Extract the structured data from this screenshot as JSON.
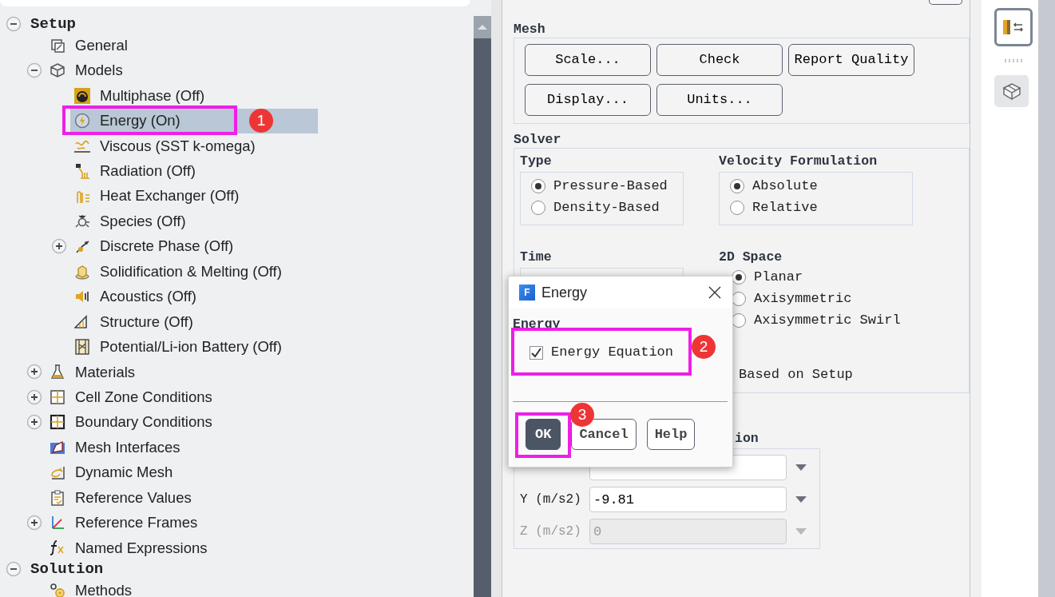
{
  "tree": [
    {
      "label": "Setup",
      "kind": "section",
      "expanded": true,
      "selected": false,
      "children": [
        {
          "label": "General",
          "kind": "general",
          "selected": false
        },
        {
          "label": "Models",
          "kind": "models",
          "expanded": true,
          "selected": false,
          "children": [
            {
              "label": "Multiphase (Off)",
              "kind": "multiphase",
              "selected": false
            },
            {
              "label": "Energy (On)",
              "kind": "energy",
              "selected": true
            },
            {
              "label": "Viscous (SST k-omega)",
              "kind": "viscous",
              "selected": false
            },
            {
              "label": "Radiation (Off)",
              "kind": "radiation",
              "selected": false
            },
            {
              "label": "Heat Exchanger (Off)",
              "kind": "exchanger",
              "selected": false
            },
            {
              "label": "Species (Off)",
              "kind": "species",
              "selected": false
            },
            {
              "label": "Discrete Phase (Off)",
              "kind": "particle",
              "expanded": false,
              "selected": false
            },
            {
              "label": "Solidification & Melting (Off)",
              "kind": "solid",
              "selected": false
            },
            {
              "label": "Acoustics (Off)",
              "kind": "acoustics",
              "selected": false
            },
            {
              "label": "Structure (Off)",
              "kind": "structure",
              "selected": false
            },
            {
              "label": "Potential/Li-ion Battery (Off)",
              "kind": "battery",
              "selected": false
            }
          ]
        },
        {
          "label": "Materials",
          "kind": "materials",
          "expanded": false,
          "selected": false
        },
        {
          "label": "Cell Zone Conditions",
          "kind": "zones",
          "expanded": false,
          "selected": false
        },
        {
          "label": "Boundary Conditions",
          "kind": "boundary",
          "expanded": false,
          "selected": false
        },
        {
          "label": "Mesh Interfaces",
          "kind": "interfaces",
          "selected": false
        },
        {
          "label": "Dynamic Mesh",
          "kind": "dynamic",
          "selected": false
        },
        {
          "label": "Reference Values",
          "kind": "values",
          "selected": false
        },
        {
          "label": "Reference Frames",
          "kind": "frames",
          "expanded": false,
          "selected": false
        },
        {
          "label": "Named Expressions",
          "kind": "expressions",
          "selected": false
        }
      ]
    },
    {
      "label": "Solution",
      "kind": "section",
      "expanded": true,
      "selected": false,
      "children": [
        {
          "label": "Methods",
          "kind": "methods",
          "selected": false
        }
      ]
    }
  ],
  "mesh": {
    "title": "Mesh",
    "buttons": [
      "Scale...",
      "Check",
      "Report Quality",
      "Display...",
      "Units..."
    ]
  },
  "solver": {
    "title": "Solver",
    "type": {
      "title": "Type",
      "options": [
        {
          "label": "Pressure-Based",
          "selected": true
        },
        {
          "label": "Density-Based",
          "selected": false
        }
      ]
    },
    "velocity": {
      "title": "Velocity Formulation",
      "options": [
        {
          "label": "Absolute",
          "selected": true
        },
        {
          "label": "Relative",
          "selected": false
        }
      ]
    },
    "time": {
      "title": "Time"
    },
    "space": {
      "title": "2D Space",
      "options": [
        {
          "label": "Planar",
          "selected": true
        },
        {
          "label": "Axisymmetric",
          "selected": false
        },
        {
          "label": "Axisymmetric Swirl",
          "selected": false
        }
      ]
    },
    "note": "Based on Setup"
  },
  "gravity": {
    "title": "ion",
    "fields": [
      {
        "disabled": false
      },
      {
        "label": "Y (m/s2)",
        "value": "-9.81",
        "disabled": false
      },
      {
        "label": "Z (m/s2)",
        "value": "0",
        "disabled": true
      }
    ]
  },
  "dialog": {
    "logo": "F",
    "title": "Energy",
    "group": "Energy",
    "checkbox": {
      "label": "Energy Equation",
      "checked": true
    },
    "buttons": [
      {
        "label": "OK",
        "primary": true
      },
      {
        "label": "Cancel",
        "primary": false
      },
      {
        "label": "Help",
        "primary": false
      }
    ]
  },
  "annotations": [
    {
      "number": "1"
    },
    {
      "number": "2"
    },
    {
      "number": "3"
    }
  ]
}
